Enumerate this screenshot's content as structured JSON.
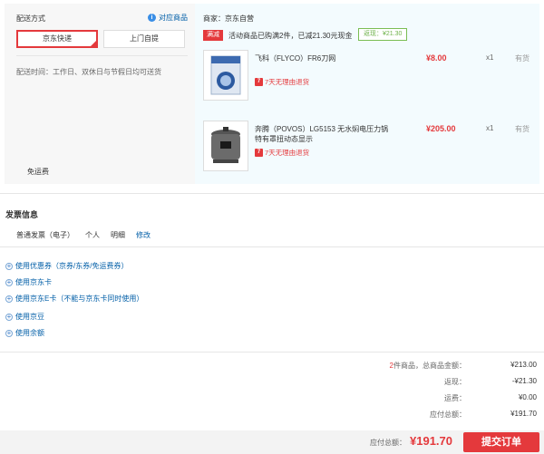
{
  "shipping": {
    "title": "配送方式",
    "link": "对应商品",
    "option_selected": "京东快递",
    "option_alt": "上门自提",
    "time": "配送时间：工作日、双休日与节假日均可送货",
    "free_shipping": "免运费"
  },
  "goods": {
    "seller": "商家：京东自营",
    "promo_tag": "满减",
    "promo_text": "活动商品已购满2件，已减21.30元现金",
    "promo_saved": "返现：¥21.30",
    "items": [
      {
        "name": "飞科（FLYCO）FR6刀网",
        "return_icon": "7",
        "return_text": "7天无理由退货",
        "price": "¥8.00",
        "qty": "x1",
        "stock": "有货"
      },
      {
        "name": "奔腾（POVOS）LG5153 无水焖电压力锅 特有罩扭动态显示",
        "return_icon": "7",
        "return_text": "7天无理由退货",
        "price": "¥205.00",
        "qty": "x1",
        "stock": "有货"
      }
    ]
  },
  "invoice": {
    "title": "发票信息",
    "type": "普通发票（电子）",
    "title_type": "个人",
    "content": "明细",
    "edit": "修改"
  },
  "options": [
    "使用优惠券（京券/东券/免运费券）",
    "使用京东卡",
    "使用京东E卡（不能与京东卡同时使用）",
    "使用京豆",
    "使用余额"
  ],
  "summary": {
    "count": "2",
    "count_label": "件商品，总商品金额：",
    "total": "¥213.00",
    "cashback_label": "返现：",
    "cashback": "-¥21.30",
    "freight_label": "运费：",
    "freight": "¥0.00",
    "due_label": "应付总额：",
    "due": "¥191.70"
  },
  "bottom": {
    "pay_label": "应付总额：",
    "pay_amount": "¥191.70",
    "submit": "提交订单"
  },
  "colors": {
    "accent_red": "#e4393c",
    "link_blue": "#005ea7",
    "green": "#6fb24b"
  }
}
